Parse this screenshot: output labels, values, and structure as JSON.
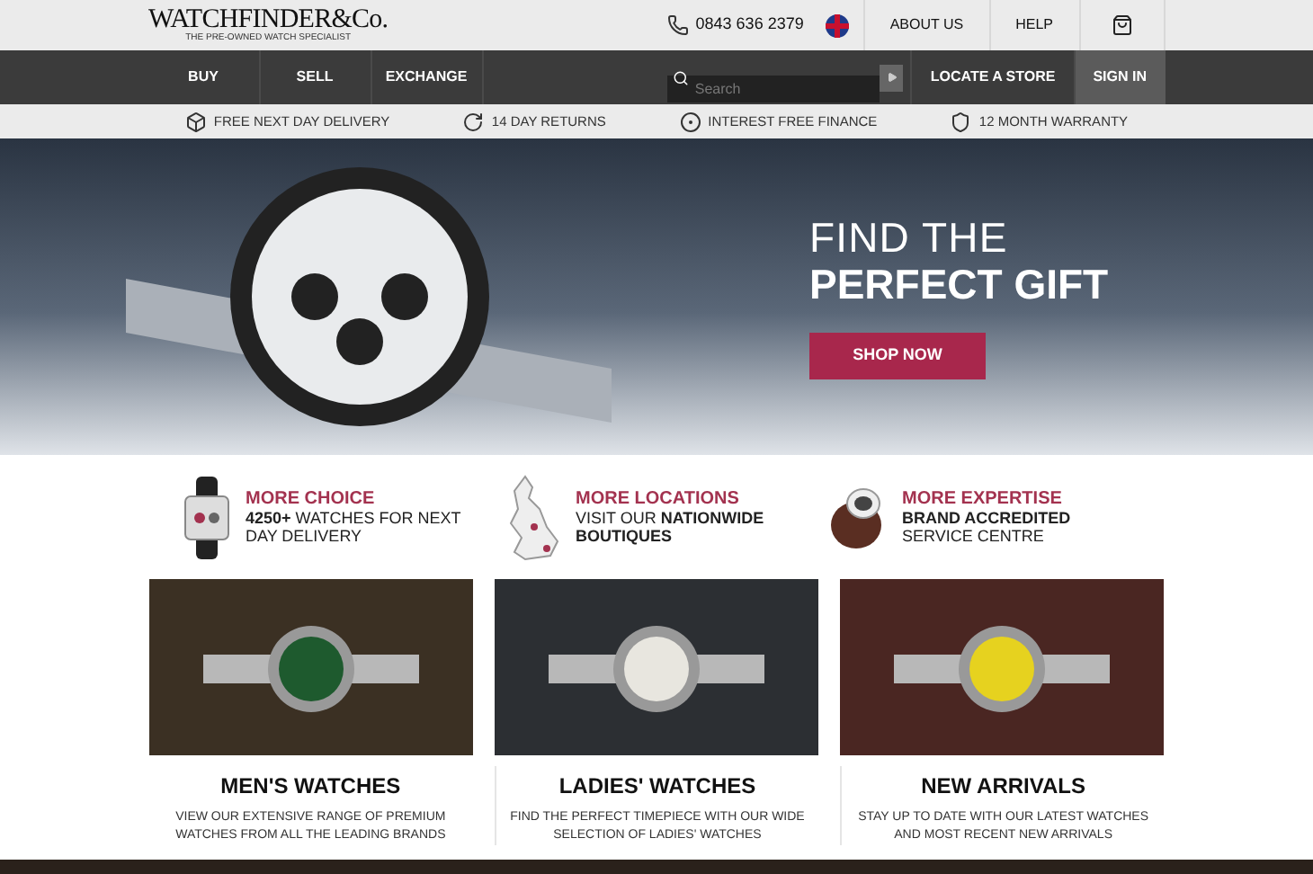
{
  "header": {
    "logo": "WATCHFINDER&Co.",
    "tagline": "THE PRE-OWNED WATCH SPECIALIST",
    "phone": "0843 636 2379",
    "links": [
      "ABOUT US",
      "HELP"
    ]
  },
  "nav": {
    "items": [
      "BUY",
      "SELL",
      "EXCHANGE"
    ],
    "search": {
      "placeholder": "Search"
    },
    "right_items": [
      {
        "label": "LOCATE A STORE",
        "selected": false
      },
      {
        "label": "SIGN IN",
        "selected": true
      }
    ]
  },
  "benefits": [
    {
      "kind": "box",
      "label": "FREE NEXT DAY DELIVERY"
    },
    {
      "kind": "returns",
      "label": "14 DAY RETURNS"
    },
    {
      "kind": "finance",
      "label": "INTEREST FREE FINANCE"
    },
    {
      "kind": "shield",
      "label": "12 MONTH WARRANTY"
    }
  ],
  "hero": {
    "title_line_1": "FIND THE",
    "title_line_2": "PERFECT GIFT",
    "button": "SHOP NOW"
  },
  "features": [
    {
      "kind": "watch",
      "title": "MORE CHOICE",
      "text": "**4250+** WATCHES FOR NEXT DAY DELIVERY"
    },
    {
      "kind": "map",
      "title": "MORE LOCATIONS",
      "text": "VISIT OUR **NATIONWIDE BOUTIQUES**"
    },
    {
      "kind": "tool",
      "title": "MORE EXPERTISE",
      "text": "**BRAND ACCREDITED** SERVICE CENTRE"
    }
  ],
  "cards": [
    {
      "title": "MEN'S WATCHES",
      "text": "VIEW OUR EXTENSIVE RANGE OF PREMIUM WATCHES FROM ALL THE LEADING BRANDS"
    },
    {
      "title": "LADIES' WATCHES",
      "text": "FIND THE PERFECT TIMEPIECE WITH OUR WIDE SELECTION OF LADIES' WATCHES"
    },
    {
      "title": "NEW ARRIVALS",
      "text": "STAY UP TO DATE WITH OUR LATEST WATCHES AND MOST RECENT NEW ARRIVALS"
    }
  ]
}
